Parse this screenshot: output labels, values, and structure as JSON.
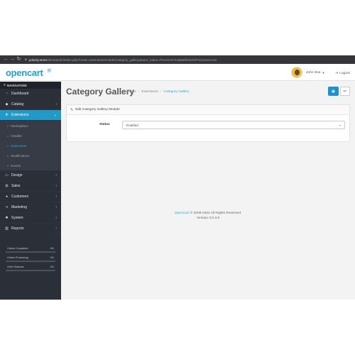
{
  "browser": {
    "url_host": "pakcity.store",
    "url_path": "/dev/admin/index.php?route=extension/module/category_gallery&user_token=PmvOn1FXuBj89lb3hZelPOryoeGx1xw"
  },
  "header": {
    "logo_text": "opencart",
    "user_name": "John Doe",
    "logout_label": "Logout"
  },
  "sidebar": {
    "nav_label": "NAVIGATION",
    "items": [
      {
        "label": "Dashboard",
        "icon": "dashboard-icon",
        "has_children": false
      },
      {
        "label": "Catalog",
        "icon": "tag-icon",
        "has_children": true
      },
      {
        "label": "Extensions",
        "icon": "puzzle-icon",
        "has_children": true,
        "active": true
      },
      {
        "label": "Design",
        "icon": "monitor-icon",
        "has_children": true
      },
      {
        "label": "Sales",
        "icon": "cart-icon",
        "has_children": true
      },
      {
        "label": "Customers",
        "icon": "user-icon",
        "has_children": true
      },
      {
        "label": "Marketing",
        "icon": "share-icon",
        "has_children": true
      },
      {
        "label": "System",
        "icon": "cog-icon",
        "has_children": true
      },
      {
        "label": "Reports",
        "icon": "bar-chart-icon",
        "has_children": true
      }
    ],
    "sub_items": [
      "Marketplace",
      "Installer",
      "Extensions",
      "Modifications",
      "Events"
    ],
    "current_sub": "Extensions",
    "stats": [
      {
        "label": "Orders Completed",
        "value": "0%"
      },
      {
        "label": "Orders Processing",
        "value": "0%"
      },
      {
        "label": "Other Statuses",
        "value": "0%"
      }
    ]
  },
  "content": {
    "page_title": "Category Gallery",
    "breadcrumb": [
      "Home",
      "Extensions",
      "Category Gallery"
    ],
    "panel_title": "Edit Category Gallery Module",
    "status_label": "Status",
    "status_value": "Enabled"
  },
  "footer": {
    "link_text": "OpenCart",
    "copyright": "© 2009-2022 All Rights Reserved.",
    "version": "Version 3.0.3.8"
  },
  "colors": {
    "accent": "#229ac8",
    "sidebar_bg": "#2b2f37",
    "primary_button": "#1e91cf"
  }
}
